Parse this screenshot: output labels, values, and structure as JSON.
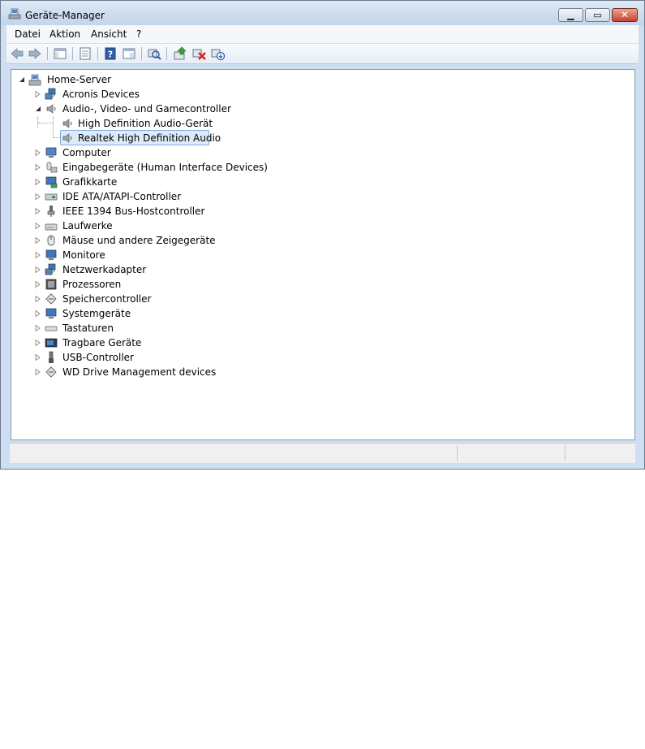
{
  "window": {
    "title": "Geräte-Manager"
  },
  "menu": {
    "items": [
      "Datei",
      "Aktion",
      "Ansicht",
      "?"
    ]
  },
  "toolbar": {
    "buttons": [
      "back-icon",
      "forward-icon",
      "show-hide-console-tree-icon",
      "properties-icon",
      "help-icon",
      "view-icon",
      "scan-hardware-icon",
      "update-driver-icon",
      "uninstall-icon",
      "disable-icon"
    ]
  },
  "tree": {
    "root": "Home-Server",
    "categories": [
      {
        "label": "Acronis Devices",
        "icon": "network-device-icon"
      },
      {
        "label": "Audio-, Video- und Gamecontroller",
        "icon": "speaker-icon",
        "expanded": true,
        "children": [
          {
            "label": "High Definition Audio-Gerät",
            "icon": "speaker-icon"
          },
          {
            "label": "Realtek High Definition Audio",
            "icon": "speaker-icon",
            "selected": true
          }
        ]
      },
      {
        "label": "Computer",
        "icon": "computer-icon"
      },
      {
        "label": "Eingabegeräte (Human Interface Devices)",
        "icon": "hid-icon"
      },
      {
        "label": "Grafikkarte",
        "icon": "display-adapter-icon"
      },
      {
        "label": "IDE ATA/ATAPI-Controller",
        "icon": "ide-controller-icon"
      },
      {
        "label": "IEEE 1394 Bus-Hostcontroller",
        "icon": "firewire-icon"
      },
      {
        "label": "Laufwerke",
        "icon": "disk-drive-icon"
      },
      {
        "label": "Mäuse und andere Zeigegeräte",
        "icon": "mouse-icon"
      },
      {
        "label": "Monitore",
        "icon": "monitor-icon"
      },
      {
        "label": "Netzwerkadapter",
        "icon": "network-adapter-icon"
      },
      {
        "label": "Prozessoren",
        "icon": "processor-icon"
      },
      {
        "label": "Speichercontroller",
        "icon": "storage-controller-icon"
      },
      {
        "label": "Systemgeräte",
        "icon": "system-device-icon"
      },
      {
        "label": "Tastaturen",
        "icon": "keyboard-icon"
      },
      {
        "label": "Tragbare Geräte",
        "icon": "portable-device-icon"
      },
      {
        "label": "USB-Controller",
        "icon": "usb-icon"
      },
      {
        "label": "WD Drive Management devices",
        "icon": "storage-controller-icon"
      }
    ]
  },
  "colors": {
    "titlebar": "#c9d9ec",
    "selection": "#dcebfc",
    "selection_border": "#84acdd",
    "close_button": "#c7432a"
  }
}
